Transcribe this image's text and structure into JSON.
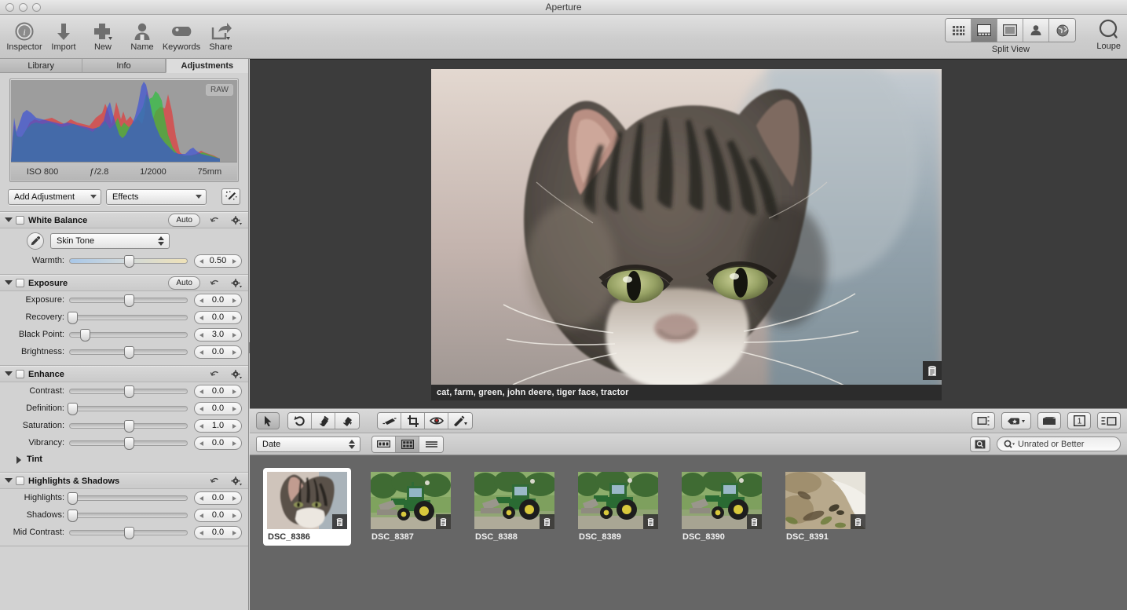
{
  "window": {
    "title": "Aperture",
    "controls": [
      "close",
      "minimize",
      "zoom"
    ]
  },
  "toolbar": {
    "items": [
      {
        "label": "Inspector",
        "icon": "info-circle-icon"
      },
      {
        "label": "Import",
        "icon": "down-arrow-icon"
      },
      {
        "label": "New",
        "icon": "plus-icon"
      },
      {
        "label": "Name",
        "icon": "person-icon"
      },
      {
        "label": "Keywords",
        "icon": "tag-icon"
      },
      {
        "label": "Share",
        "icon": "share-arrow-icon"
      }
    ],
    "view_modes": [
      {
        "name": "browser-grid-view",
        "icon": "grid-icon",
        "active": false
      },
      {
        "name": "split-view",
        "icon": "split-view-icon",
        "active": true
      },
      {
        "name": "viewer-view",
        "icon": "viewer-icon",
        "active": false
      },
      {
        "name": "faces-view",
        "icon": "face-icon",
        "active": false
      },
      {
        "name": "places-view",
        "icon": "globe-icon",
        "active": false
      }
    ],
    "split_view_label": "Split View",
    "loupe_label": "Loupe",
    "loupe_icon": "loupe-icon"
  },
  "inspector": {
    "tabs": [
      {
        "label": "Library",
        "active": false
      },
      {
        "label": "Info",
        "active": false
      },
      {
        "label": "Adjustments",
        "active": true
      }
    ],
    "histogram": {
      "raw_badge": "RAW",
      "exif": [
        "ISO 800",
        "ƒ/2.8",
        "1/2000",
        "75mm"
      ]
    },
    "add_adjustment_label": "Add Adjustment",
    "effects_label": "Effects",
    "wand_icon": "magic-wand-icon",
    "blocks": [
      {
        "title": "White Balance",
        "expanded": true,
        "checked": false,
        "auto": "Auto",
        "has_auto": true,
        "eyedropper_icon": "eyedropper-icon",
        "preset": "Skin Tone",
        "sliders": [
          {
            "label": "Warmth:",
            "value": "0.50",
            "pos": 50,
            "track": "warm"
          }
        ]
      },
      {
        "title": "Exposure",
        "expanded": true,
        "checked": false,
        "auto": "Auto",
        "has_auto": true,
        "sliders": [
          {
            "label": "Exposure:",
            "value": "0.0",
            "pos": 50
          },
          {
            "label": "Recovery:",
            "value": "0.0",
            "pos": 1
          },
          {
            "label": "Black Point:",
            "value": "3.0",
            "pos": 12
          },
          {
            "label": "Brightness:",
            "value": "0.0",
            "pos": 50
          }
        ]
      },
      {
        "title": "Enhance",
        "expanded": true,
        "checked": false,
        "has_auto": false,
        "sliders": [
          {
            "label": "Contrast:",
            "value": "0.0",
            "pos": 50
          },
          {
            "label": "Definition:",
            "value": "0.0",
            "pos": 1
          },
          {
            "label": "Saturation:",
            "value": "1.0",
            "pos": 50
          },
          {
            "label": "Vibrancy:",
            "value": "0.0",
            "pos": 50
          }
        ],
        "subsection": {
          "title": "Tint",
          "expanded": false
        }
      },
      {
        "title": "Highlights & Shadows",
        "expanded": true,
        "checked": false,
        "has_auto": false,
        "sliders": [
          {
            "label": "Highlights:",
            "value": "0.0",
            "pos": 1
          },
          {
            "label": "Shadows:",
            "value": "0.0",
            "pos": 1
          },
          {
            "label": "Mid Contrast:",
            "value": "0.0",
            "pos": 50
          }
        ]
      }
    ]
  },
  "viewer": {
    "caption_keywords": "cat, farm, green, john deere, tiger face, tractor",
    "badge_icon": "metadata-badge-icon"
  },
  "filmstrip_tools": {
    "left_buttons": [
      {
        "name": "select-tool",
        "icon": "arrow-cursor-icon",
        "active": true
      }
    ],
    "rotate_group": [
      {
        "name": "rotate-left-button",
        "icon": "rotate-left-icon"
      },
      {
        "name": "lift-button",
        "icon": "lift-icon"
      },
      {
        "name": "stamp-button",
        "icon": "stamp-icon"
      }
    ],
    "edit_group": [
      {
        "name": "straighten-tool",
        "icon": "straighten-icon"
      },
      {
        "name": "crop-tool",
        "icon": "crop-icon"
      },
      {
        "name": "red-eye-tool",
        "icon": "red-eye-icon"
      },
      {
        "name": "retouch-tool",
        "icon": "brush-icon"
      }
    ],
    "right_buttons": [
      {
        "name": "new-album-button",
        "icon": "album-icon"
      },
      {
        "name": "keyword-preset-button",
        "icon": "keyword-star-icon"
      },
      {
        "name": "filmstrip-toggle-button",
        "icon": "filmstrip-icon"
      },
      {
        "name": "primary-only-button",
        "icon": "one-icon",
        "label": "1"
      },
      {
        "name": "metadata-overlay-button",
        "icon": "metadata-view-icon"
      }
    ],
    "sort_label": "Date",
    "layout_buttons": [
      {
        "name": "filmstrip-layout-button",
        "icon": "filmstrip-layout-icon",
        "active": false
      },
      {
        "name": "grid-layout-button",
        "icon": "grid-layout-icon",
        "active": true
      },
      {
        "name": "list-layout-button",
        "icon": "list-layout-icon",
        "active": false
      }
    ],
    "search_toggle_icon": "search-toggle-icon",
    "search": {
      "placeholder": "Unrated or Better",
      "value": "Unrated or Better",
      "icon": "search-magnifier-icon"
    }
  },
  "filmstrip": {
    "thumbnails": [
      {
        "label": "DSC_8386",
        "selected": true,
        "subject": "cat"
      },
      {
        "label": "DSC_8387",
        "selected": false,
        "subject": "tractor"
      },
      {
        "label": "DSC_8388",
        "selected": false,
        "subject": "tractor"
      },
      {
        "label": "DSC_8389",
        "selected": false,
        "subject": "tractor"
      },
      {
        "label": "DSC_8390",
        "selected": false,
        "subject": "tractor"
      },
      {
        "label": "DSC_8391",
        "selected": false,
        "subject": "cat-ground"
      }
    ]
  },
  "colors": {
    "viewer_background": "#3c3c3c",
    "filmstrip_background": "#666666",
    "panel_background": "#d2d2d2",
    "caption_background": "#2c2c2c"
  }
}
